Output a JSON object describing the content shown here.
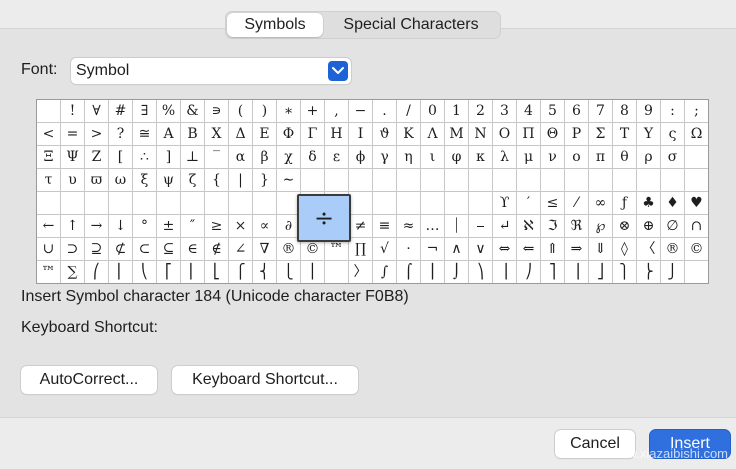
{
  "tabs": {
    "symbols": "Symbols",
    "special": "Special Characters"
  },
  "font": {
    "label": "Font:",
    "value": "Symbol"
  },
  "grid": {
    "rows": [
      [
        " ",
        "!",
        "∀",
        "#",
        "∃",
        "%",
        "&",
        "∍",
        "(",
        ")",
        "∗",
        "+",
        ",",
        "−",
        ".",
        "/",
        "0",
        "1",
        "2",
        "3",
        "4",
        "5",
        "6",
        "7",
        "8",
        "9",
        ":",
        ";"
      ],
      [
        "<",
        "=",
        ">",
        "?",
        "≅",
        "Α",
        "Β",
        "Χ",
        "Δ",
        "Ε",
        "Φ",
        "Γ",
        "Η",
        "Ι",
        "ϑ",
        "Κ",
        "Λ",
        "Μ",
        "Ν",
        "Ο",
        "Π",
        "Θ",
        "Ρ",
        "Σ",
        "Τ",
        "Υ",
        "ς",
        "Ω"
      ],
      [
        "Ξ",
        "Ψ",
        "Ζ",
        "[",
        "∴",
        "]",
        "⊥",
        "‾",
        "α",
        "β",
        "χ",
        "δ",
        "ε",
        "ϕ",
        "γ",
        "η",
        "ι",
        "φ",
        "κ",
        "λ",
        "μ",
        "ν",
        "ο",
        "π",
        "θ",
        "ρ",
        "σ"
      ],
      [
        "τ",
        "υ",
        "ϖ",
        "ω",
        "ξ",
        "ψ",
        "ζ",
        "{",
        "|",
        "}",
        "∼",
        "",
        "",
        "",
        "",
        "",
        "",
        "",
        "",
        "",
        "",
        "",
        "",
        "",
        "",
        "",
        "",
        ""
      ],
      [
        "",
        "",
        "",
        "",
        "",
        "",
        "",
        "",
        "",
        "",
        "",
        "",
        "",
        "",
        "",
        "",
        "",
        "",
        "",
        "ϒ",
        "′",
        "≤",
        "⁄",
        "∞",
        "ƒ",
        "♣",
        "♦",
        "♥",
        "♠",
        "↔"
      ],
      [
        "←",
        "↑",
        "→",
        "↓",
        "°",
        "±",
        "″",
        "≥",
        "×",
        "∝",
        "∂",
        "•",
        "÷",
        "≠",
        "≡",
        "≈",
        "…",
        "⏐",
        "⎯",
        "↵",
        "ℵ",
        "ℑ",
        "ℜ",
        "℘",
        "⊗",
        "⊕",
        "∅",
        "∩"
      ],
      [
        "∪",
        "⊃",
        "⊇",
        "⊄",
        "⊂",
        "⊆",
        "∈",
        "∉",
        "∠",
        "∇",
        "®",
        "©",
        "™",
        "∏",
        "√",
        "⋅",
        "¬",
        "∧",
        "∨",
        "⇔",
        "⇐",
        "⇑",
        "⇒",
        "⇓",
        "◊",
        "〈",
        "®",
        "©"
      ],
      [
        "™",
        "∑",
        "⎛",
        "⎜",
        "⎝",
        "⎡",
        "⎢",
        "⎣",
        "⎧",
        "⎨",
        "⎩",
        "⎪",
        "",
        "〉",
        "∫",
        "⌠",
        "⎮",
        "⌡",
        "⎞",
        "⎟",
        "⎠",
        "⎤",
        "⎥",
        "⎦",
        "⎫",
        "⎬",
        "⎭",
        ""
      ]
    ],
    "selected_glyph": "÷"
  },
  "info": {
    "insert_line": "Insert Symbol character 184  (Unicode character F0B8)",
    "shortcut_label": "Keyboard Shortcut:"
  },
  "buttons": {
    "autocorrect": "AutoCorrect...",
    "keyboard_shortcut": "Keyboard Shortcut...",
    "cancel": "Cancel",
    "insert": "Insert"
  },
  "watermark": "www.xiazaibishi.com"
}
